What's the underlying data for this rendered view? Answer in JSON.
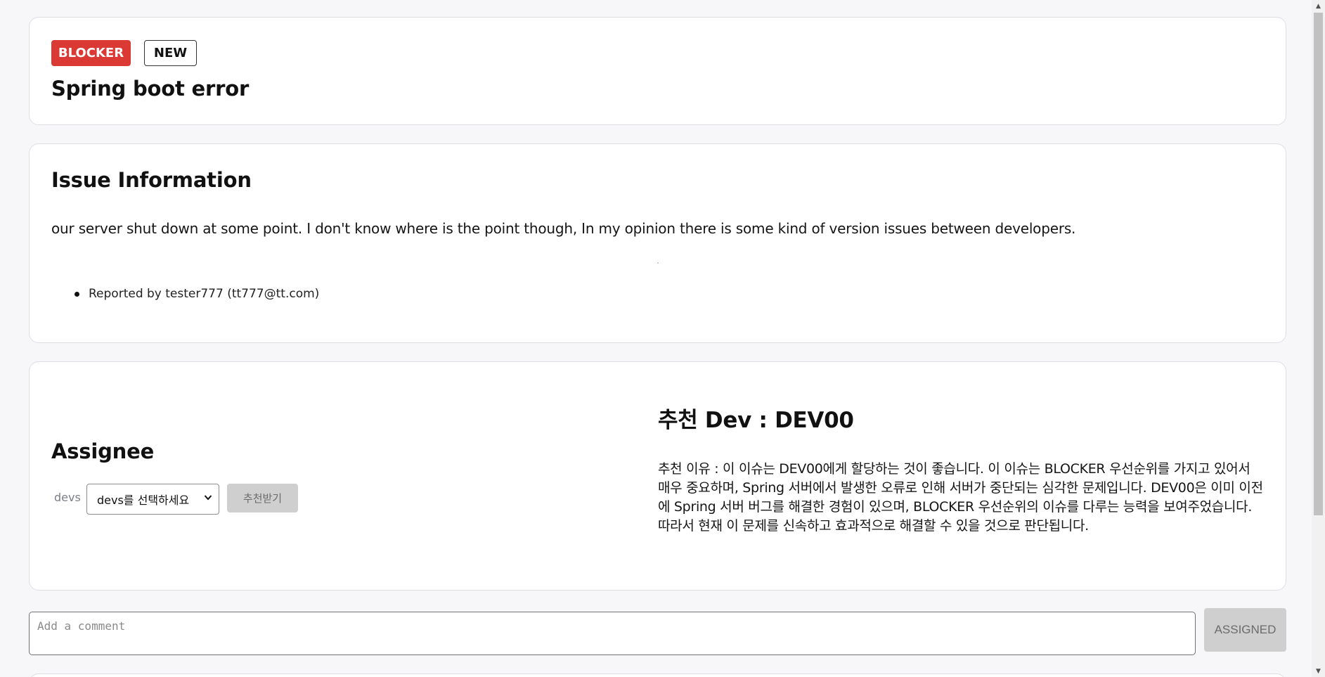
{
  "issue": {
    "priority": "BLOCKER",
    "status": "NEW",
    "title": "Spring boot error"
  },
  "info": {
    "section_title": "Issue Information",
    "description": "our server shut down at some point. I don't know where is the point though, In my opinion there is some kind of version issues between developers.",
    "reporter": "Reported by tester777 (tt777@tt.com)"
  },
  "assignee": {
    "section_title": "Assignee",
    "devs_label": "devs",
    "devs_select_value": "devs를 선택하세요",
    "recommend_button": "추천받기",
    "recommendation_title": "추천 Dev : DEV00",
    "recommendation_reason": "추천 이유 : 이 이슈는 DEV00에게 할당하는 것이 좋습니다. 이 이슈는 BLOCKER 우선순위를 가지고 있어서 매우 중요하며, Spring 서버에서 발생한 오류로 인해 서버가 중단되는 심각한 문제입니다. DEV00은 이미 이전에 Spring 서버 버그를 해결한 경험이 있으며, BLOCKER 우선순위의 이슈를 다루는 능력을 보여주었습니다. 따라서 현재 이 문제를 신속하고 효과적으로 해결할 수 있을 것으로 판단됩니다."
  },
  "comment": {
    "placeholder": "Add a comment",
    "submit_button": "ASSIGNED"
  },
  "colors": {
    "priority_badge": "#db3a34",
    "page_background": "#f7f7f9",
    "disabled_button": "#cfcfcf"
  },
  "icons": {
    "select_chevron": "chevron-down-icon",
    "bullet": "bullet-icon"
  }
}
